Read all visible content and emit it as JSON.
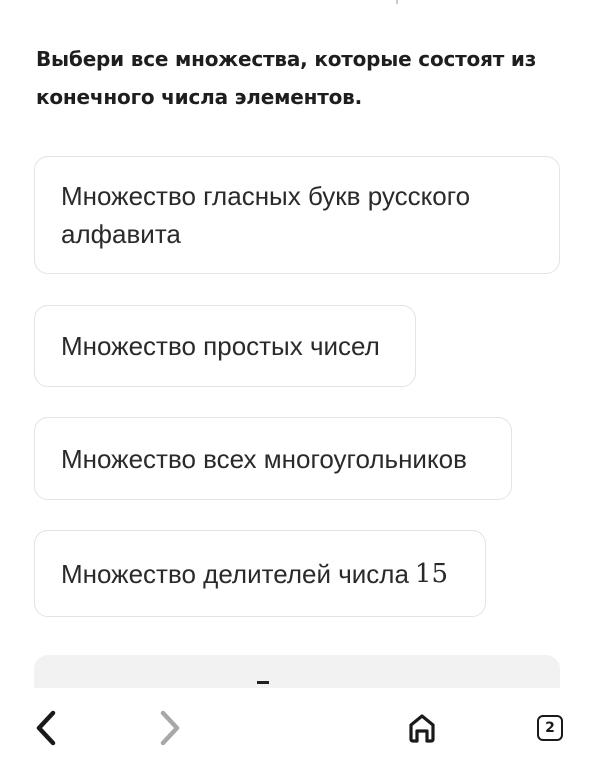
{
  "question": {
    "text": "Выбери все множества, которые состоят из конечного числа элементов."
  },
  "options": [
    {
      "label": "Множество гласных букв русского алфавита",
      "number": ""
    },
    {
      "label": "Множество простых чисел",
      "number": ""
    },
    {
      "label": "Множество всех многоугольников",
      "number": ""
    },
    {
      "label": "Множество делителей числа",
      "number": "15"
    }
  ],
  "navbar": {
    "back_icon": "chevron-left-icon",
    "forward_icon": "chevron-right-icon",
    "home_icon": "home-icon",
    "tabs_count": "2"
  },
  "colors": {
    "text": "#1e1e1e",
    "option_border": "#e3e3e3",
    "disabled_icon": "#a8a8a8",
    "panel_bg": "#f2f2f2"
  }
}
